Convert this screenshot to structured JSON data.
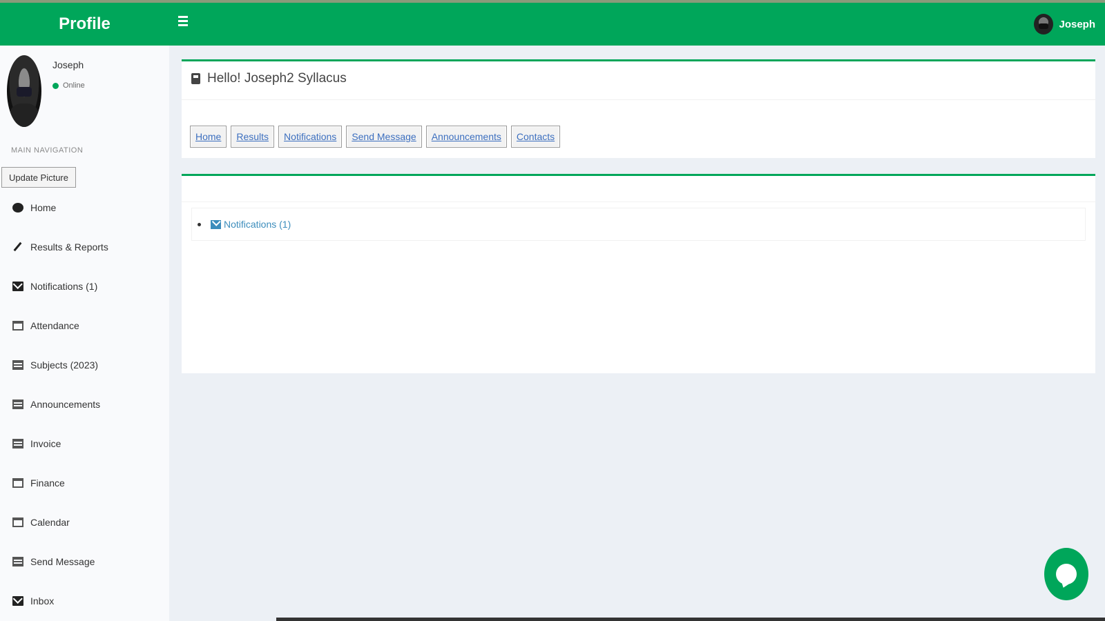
{
  "header": {
    "brand": "Profile",
    "user_name": "Joseph"
  },
  "sidebar": {
    "user_name": "Joseph",
    "status": "Online",
    "nav_header": "MAIN NAVIGATION",
    "update_picture": "Update Picture",
    "items": [
      {
        "label": "Home",
        "icon": "home-icon"
      },
      {
        "label": "Results & Reports",
        "icon": "pencil-icon"
      },
      {
        "label": "Notifications (1)",
        "icon": "envelope-icon"
      },
      {
        "label": "Attendance",
        "icon": "calendar-icon"
      },
      {
        "label": "Subjects (2023)",
        "icon": "table-icon"
      },
      {
        "label": "Announcements",
        "icon": "table-icon"
      },
      {
        "label": "Invoice",
        "icon": "table-icon"
      },
      {
        "label": "Finance",
        "icon": "calendar-icon"
      },
      {
        "label": "Calendar",
        "icon": "calendar-icon"
      },
      {
        "label": "Send Message",
        "icon": "table-icon"
      },
      {
        "label": "Inbox",
        "icon": "envelope-icon"
      }
    ]
  },
  "main": {
    "greeting": "Hello! Joseph2  Syllacus",
    "tabs": [
      "Home",
      "Results",
      "Notifications",
      "Send Message",
      "Announcements",
      "Contacts"
    ],
    "notification_link": "Notifications (1)"
  },
  "colors": {
    "brand_green": "#00a65a",
    "link_blue": "#3c8dbc"
  }
}
